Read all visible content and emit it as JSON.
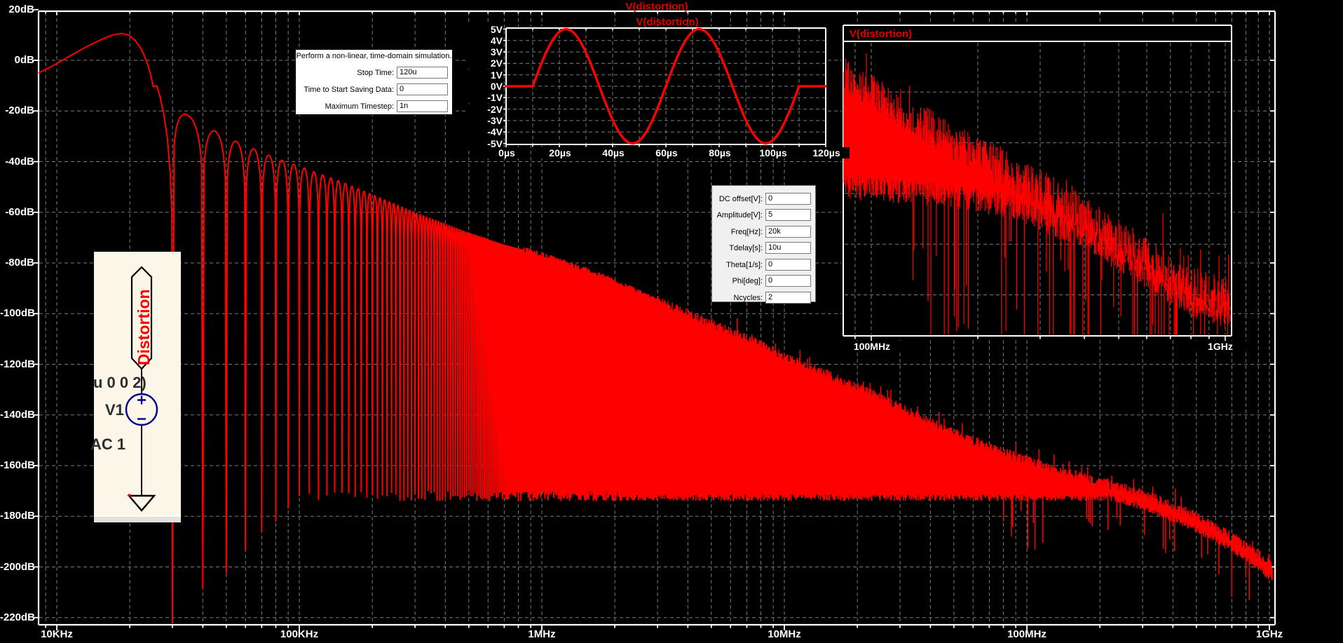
{
  "window": {
    "name": "LTspice waveform viewer with schematic and simulation dialogs"
  },
  "colors": {
    "background": "#000000",
    "grid": "#7b7b7b",
    "axis": "#ffffff",
    "trace": "#ff0000",
    "title": "#dd0000",
    "schematic_bg": "#fbf6e7",
    "schematic_symbol": "#00008b",
    "schematic_text": "#2e2e2e",
    "dialog_bg": "#ffffff",
    "param_bg": "#f0f0f0"
  },
  "main_plot": {
    "title": "V(distortion)",
    "y_labels": [
      "20dB",
      "0dB",
      "-20dB",
      "-40dB",
      "-60dB",
      "-80dB",
      "-100dB",
      "-120dB",
      "-140dB",
      "-160dB",
      "-180dB",
      "-200dB",
      "-220dB"
    ],
    "x_labels": [
      "10KHz",
      "100KHz",
      "1MHz",
      "10MHz",
      "100MHz",
      "1GHz"
    ]
  },
  "time_inset": {
    "title": "V(distortion)",
    "y_labels": [
      "5V",
      "4V",
      "3V",
      "2V",
      "1V",
      "0V",
      "-1V",
      "-2V",
      "-3V",
      "-4V",
      "-5V"
    ],
    "x_labels": [
      "0µs",
      "20µs",
      "40µs",
      "60µs",
      "80µs",
      "100µs",
      "120µs"
    ]
  },
  "fft_inset": {
    "title": "V(distortion)",
    "x_labels": [
      "100MHz",
      "1GHz"
    ]
  },
  "sim_dialog": {
    "heading": "Perform a non-linear, time-domain simulation.",
    "fields": [
      {
        "label": "Stop Time:",
        "value": "120u"
      },
      {
        "label": "Time to Start Saving Data:",
        "value": "0"
      },
      {
        "label": "Maximum Timestep:",
        "value": "1n"
      }
    ]
  },
  "param_dialog": {
    "fields": [
      {
        "label": "DC offset[V]:",
        "value": "0"
      },
      {
        "label": "Amplitude[V]:",
        "value": "5"
      },
      {
        "label": "Freq[Hz]:",
        "value": "20k"
      },
      {
        "label": "Tdelay[s]:",
        "value": "10u"
      },
      {
        "label": "Theta[1/s]:",
        "value": "0"
      },
      {
        "label": "Phi[deg]:",
        "value": "0"
      },
      {
        "label": "Ncycles:",
        "value": "2"
      }
    ]
  },
  "schematic": {
    "net_label": "Distortion",
    "spice_fragment": "u 0 0 2)",
    "instance_name": "V1",
    "ac_spec": "AC 1"
  },
  "chart_data": [
    {
      "id": "main_fft",
      "type": "line",
      "title": "V(distortion)",
      "x_axis": {
        "scale": "log",
        "unit": "Hz",
        "tick_labels": [
          "10KHz",
          "100KHz",
          "1MHz",
          "10MHz",
          "100MHz",
          "1GHz"
        ],
        "tick_values": [
          10000,
          100000,
          1000000,
          10000000,
          100000000,
          1000000000
        ],
        "range_hz": [
          8400,
          1030000000
        ]
      },
      "y_axis": {
        "unit": "dB",
        "tick_labels": [
          "20dB",
          "0dB",
          "-20dB",
          "-40dB",
          "-60dB",
          "-80dB",
          "-100dB",
          "-120dB",
          "-140dB",
          "-160dB",
          "-180dB",
          "-200dB",
          "-220dB"
        ],
        "tick_values": [
          20,
          0,
          -20,
          -40,
          -60,
          -80,
          -100,
          -120,
          -140,
          -160,
          -180,
          -200,
          -220
        ]
      },
      "grid": true,
      "legend_position": "top-center",
      "series": [
        {
          "name": "V(distortion)",
          "color": "#ff0000",
          "kind": "fft_magnitude",
          "peak_db": 10.6,
          "peak_hz": 18500,
          "first_null_hz": 30000,
          "null_spacing_hz": 10000,
          "noise_floor_db": -172,
          "main_lobe_db": [
            [
              8400,
              -5
            ],
            [
              9500,
              -2.5
            ],
            [
              11000,
              1
            ],
            [
              12500,
              4
            ],
            [
              14000,
              6.5
            ],
            [
              15500,
              8.5
            ],
            [
              17000,
              10
            ],
            [
              18500,
              10.6
            ],
            [
              19800,
              10
            ],
            [
              21000,
              8
            ],
            [
              22300,
              4.5
            ],
            [
              23400,
              0
            ],
            [
              24300,
              -5
            ],
            [
              25000,
              -10.5
            ],
            [
              25800,
              -10
            ],
            [
              26600,
              -14
            ],
            [
              27600,
              -21
            ],
            [
              28600,
              -31
            ],
            [
              29400,
              -45
            ],
            [
              29800,
              -60
            ]
          ],
          "sidelobe_envelope_db": [
            [
              30000,
              -16
            ],
            [
              35000,
              -22
            ],
            [
              45000,
              -28
            ],
            [
              55000,
              -32
            ],
            [
              65000,
              -35
            ],
            [
              75000,
              -37.5
            ],
            [
              85000,
              -39.5
            ],
            [
              95000,
              -41
            ],
            [
              115000,
              -44
            ],
            [
              150000,
              -48
            ],
            [
              200000,
              -53
            ],
            [
              300000,
              -60
            ],
            [
              500000,
              -68
            ],
            [
              700000,
              -72.5
            ],
            [
              1000000,
              -76.5
            ],
            [
              1500000,
              -82.5
            ],
            [
              2000000,
              -87
            ],
            [
              3000000,
              -95
            ]
          ],
          "hf_envelope_db": [
            [
              3000000,
              -95
            ],
            [
              5000000,
              -104
            ],
            [
              7000000,
              -110
            ],
            [
              10000000,
              -117
            ],
            [
              15000000,
              -124
            ],
            [
              20000000,
              -129
            ],
            [
              30000000,
              -137
            ],
            [
              50000000,
              -147
            ],
            [
              70000000,
              -153
            ],
            [
              100000000,
              -158
            ],
            [
              150000000,
              -163
            ],
            [
              200000000,
              -166.5
            ],
            [
              300000000,
              -171
            ],
            [
              500000000,
              -180
            ],
            [
              700000000,
              -188
            ],
            [
              900000000,
              -195
            ],
            [
              1030000000,
              -200
            ]
          ],
          "null_depth_db": [
            [
              30000,
              -222
            ],
            [
              100000,
              -172
            ]
          ]
        }
      ]
    },
    {
      "id": "time_waveform",
      "type": "line",
      "title": "V(distortion)",
      "x_axis": {
        "unit": "µs",
        "tick_labels": [
          "0µs",
          "20µs",
          "40µs",
          "60µs",
          "80µs",
          "100µs",
          "120µs"
        ],
        "tick_values": [
          0,
          20,
          40,
          60,
          80,
          100,
          120
        ],
        "range_us": [
          0,
          120
        ]
      },
      "y_axis": {
        "unit": "V",
        "tick_labels": [
          "5V",
          "4V",
          "3V",
          "2V",
          "1V",
          "0V",
          "-1V",
          "-2V",
          "-3V",
          "-4V",
          "-5V"
        ],
        "tick_values": [
          5,
          4,
          3,
          2,
          1,
          0,
          -1,
          -2,
          -3,
          -4,
          -5
        ],
        "range_v": [
          -5,
          5
        ]
      },
      "grid": true,
      "series": [
        {
          "name": "V(distortion)",
          "color": "#ff0000",
          "waveform": "delayed_sine_burst",
          "amplitude_v": 5,
          "freq_hz": 20000,
          "tdelay_us": 10,
          "ncycles": 2,
          "value_before_after_v": 0
        }
      ]
    },
    {
      "id": "fft_zoom",
      "type": "line",
      "title": "V(distortion)",
      "x_axis": {
        "scale": "log",
        "unit": "Hz",
        "tick_labels": [
          "100MHz",
          "1GHz"
        ],
        "tick_values": [
          100000000,
          1000000000
        ],
        "range_hz": [
          83000000,
          1044000000
        ]
      },
      "y_axis": {
        "unit": "dB",
        "labels_visible": false,
        "range_db": [
          -148,
          -194.5
        ]
      },
      "grid": true,
      "series": [
        {
          "name": "V(distortion)",
          "color": "#ff0000",
          "kind": "fft_magnitude_noisy_band",
          "top_envelope_db": [
            [
              83000000,
              -153
            ],
            [
              100000000,
              -156
            ],
            [
              150000000,
              -162
            ],
            [
              200000000,
              -166
            ],
            [
              300000000,
              -171
            ],
            [
              500000000,
              -179
            ],
            [
              700000000,
              -184
            ],
            [
              850000000,
              -187
            ],
            [
              1044000000,
              -188.5
            ]
          ],
          "bottom_envelope_db": [
            [
              83000000,
              -171
            ],
            [
              150000000,
              -172
            ],
            [
              250000000,
              -174
            ],
            [
              400000000,
              -179
            ],
            [
              600000000,
              -185
            ],
            [
              800000000,
              -189.5
            ],
            [
              1044000000,
              -191.5
            ]
          ]
        }
      ]
    }
  ]
}
